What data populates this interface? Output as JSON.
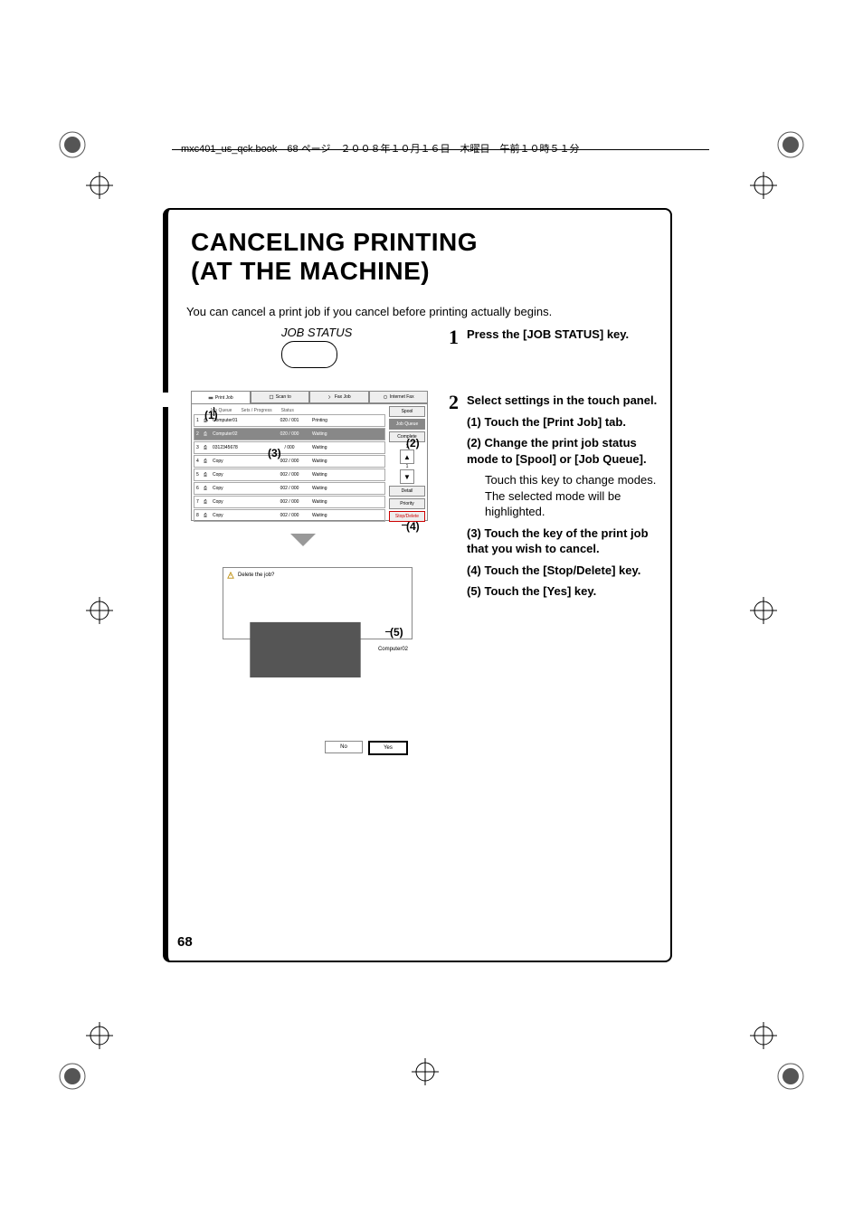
{
  "header": "mxc401_us_qck.book　68 ページ　２００８年１０月１６日　木曜日　午前１０時５１分",
  "page_num": "68",
  "title_l1": "CANCELING PRINTING",
  "title_l2": "(AT THE MACHINE)",
  "intro": "You can cancel a print job if you cancel before printing actually begins.",
  "js_label": "JOB STATUS",
  "step1": "Press the [JOB STATUS] key.",
  "step2_head": "Select settings in the touch panel.",
  "s2_1": "(1) Touch the [Print Job] tab.",
  "s2_2": "(2) Change the print job status mode to [Spool] or [Job Queue].",
  "s2_2b": "Touch this key to change modes. The selected mode will be highlighted.",
  "s2_3": "(3) Touch the key of the print job that you wish to cancel.",
  "s2_4": "(4) Touch the [Stop/Delete] key.",
  "s2_5": "(5) Touch the [Yes] key.",
  "tabs": {
    "print": "Print Job",
    "scan": "Scan to",
    "fax": "Fax Job",
    "ifax": "Internet Fax"
  },
  "qhead": {
    "jq": "Job Queue",
    "sp": "Sets / Progress",
    "st": "Status"
  },
  "rows": [
    {
      "n": "1",
      "nm": "Computer01",
      "sp": "020 / 001",
      "st": "Printing"
    },
    {
      "n": "2",
      "nm": "Computer02",
      "sp": "020 / 000",
      "st": "Waiting"
    },
    {
      "n": "3",
      "nm": "0312345678",
      "sp": "/ 000",
      "st": "Waiting"
    },
    {
      "n": "4",
      "nm": "Copy",
      "sp": "002 / 000",
      "st": "Waiting"
    },
    {
      "n": "5",
      "nm": "Copy",
      "sp": "002 / 000",
      "st": "Waiting"
    },
    {
      "n": "6",
      "nm": "Copy",
      "sp": "002 / 000",
      "st": "Waiting"
    },
    {
      "n": "7",
      "nm": "Copy",
      "sp": "002 / 000",
      "st": "Waiting"
    },
    {
      "n": "8",
      "nm": "Copy",
      "sp": "002 / 000",
      "st": "Waiting"
    }
  ],
  "side": {
    "spool": "Spool",
    "jq": "Job Queue",
    "complete": "Complete",
    "detail": "Detail",
    "priority": "Priority",
    "stop": "Stop/Delete",
    "up": "1",
    "dn": "1"
  },
  "dialog": {
    "q": "Delete the job?",
    "item": "Computer02",
    "no": "No",
    "yes": "Yes"
  },
  "call": {
    "c1": "(1)",
    "c2": "(2)",
    "c3": "(3)",
    "c4": "(4)",
    "c5": "(5)"
  }
}
